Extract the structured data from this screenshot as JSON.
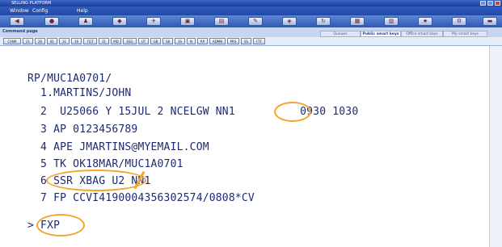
{
  "window": {
    "title": "SELLING PLATFORM"
  },
  "menu": [
    {
      "label": "Window"
    },
    {
      "label": "Config"
    },
    {
      "label": "Help"
    }
  ],
  "toolbar_icons": [
    "arrow-left-icon",
    "globe-icon",
    "people-icon",
    "car-icon",
    "plane-icon",
    "hotel-icon",
    "document-icon",
    "pencil-icon",
    "tag-icon",
    "refresh-icon",
    "grid-icon",
    "chart-icon",
    "star-icon",
    "settings-icon",
    "folder-icon"
  ],
  "command_page": {
    "label": "Command page"
  },
  "tabs": [
    {
      "label": "Queues"
    },
    {
      "label": "Public smart keys"
    },
    {
      "label": "Office smart keys"
    },
    {
      "label": "My smart keys"
    }
  ],
  "smart_keys": [
    "CANR",
    "21",
    "26",
    "81",
    "31",
    "16",
    "TGT",
    "31",
    "MD",
    "SSG",
    "UT",
    "GB",
    "S8",
    "3S",
    "N",
    "RP",
    "ADMN",
    "PRS",
    "SS",
    "FTF"
  ],
  "terminal": {
    "lines": [
      "RP/MUC1A0701/",
      "  1.MARTINS/JOHN",
      "  2  U25066 Y 15JUL 2 NCELGW NN1          0930 1030",
      "  3 AP 0123456789",
      "  4 APE JMARTINS@MYEMAIL.COM",
      "  5 TK OK18MAR/MUC1A0701",
      "  6 SSR XBAG U2 NN1",
      "  7 FP CCVI4190004356302574/0808*CV",
      "",
      "> FXP"
    ]
  }
}
